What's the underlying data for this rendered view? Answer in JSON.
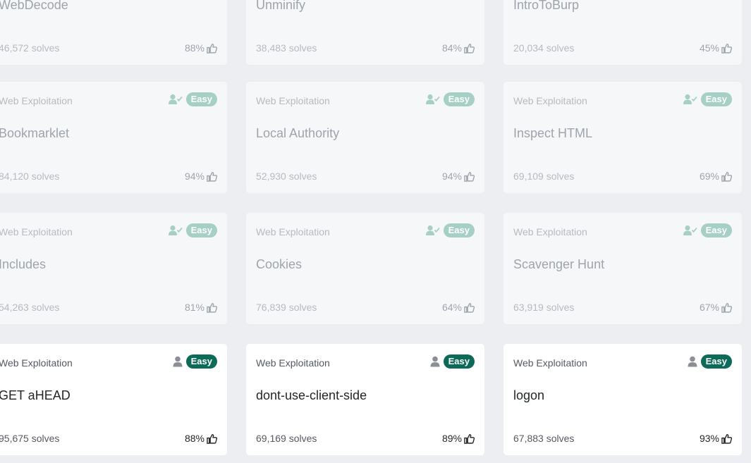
{
  "colors": {
    "page_bg": "#eceef2",
    "card_bg": "#ffffff",
    "solved_card_bg": "#f6f7f9",
    "easy_badge": "#0c6b58",
    "easy_badge_solved": "#a6cfc5",
    "solved_check": "#a6cfc5"
  },
  "rows": [
    {
      "cards": [
        {
          "category": "",
          "name": "WebDecode",
          "solves": "46,572 solves",
          "rating": "88%",
          "difficulty": "",
          "solved": true
        },
        {
          "category": "",
          "name": "Unminify",
          "solves": "38,483 solves",
          "rating": "84%",
          "difficulty": "",
          "solved": true
        },
        {
          "category": "",
          "name": "IntroToBurp",
          "solves": "20,034 solves",
          "rating": "45%",
          "difficulty": "",
          "solved": true
        }
      ]
    },
    {
      "cards": [
        {
          "category": "Web Exploitation",
          "name": "Bookmarklet",
          "solves": "84,120 solves",
          "rating": "94%",
          "difficulty": "Easy",
          "solved": true
        },
        {
          "category": "Web Exploitation",
          "name": "Local Authority",
          "solves": "52,930 solves",
          "rating": "94%",
          "difficulty": "Easy",
          "solved": true
        },
        {
          "category": "Web Exploitation",
          "name": "Inspect HTML",
          "solves": "69,109 solves",
          "rating": "69%",
          "difficulty": "Easy",
          "solved": true
        }
      ]
    },
    {
      "cards": [
        {
          "category": "Web Exploitation",
          "name": "Includes",
          "solves": "54,263 solves",
          "rating": "81%",
          "difficulty": "Easy",
          "solved": true
        },
        {
          "category": "Web Exploitation",
          "name": "Cookies",
          "solves": "76,839 solves",
          "rating": "64%",
          "difficulty": "Easy",
          "solved": true
        },
        {
          "category": "Web Exploitation",
          "name": "Scavenger Hunt",
          "solves": "63,919 solves",
          "rating": "67%",
          "difficulty": "Easy",
          "solved": true
        }
      ]
    },
    {
      "cards": [
        {
          "category": "Web Exploitation",
          "name": "GET aHEAD",
          "solves": "95,675 solves",
          "rating": "88%",
          "difficulty": "Easy",
          "solved": false
        },
        {
          "category": "Web Exploitation",
          "name": "dont-use-client-side",
          "solves": "69,169 solves",
          "rating": "89%",
          "difficulty": "Easy",
          "solved": false
        },
        {
          "category": "Web Exploitation",
          "name": "logon",
          "solves": "67,883 solves",
          "rating": "93%",
          "difficulty": "Easy",
          "solved": false
        }
      ]
    }
  ]
}
